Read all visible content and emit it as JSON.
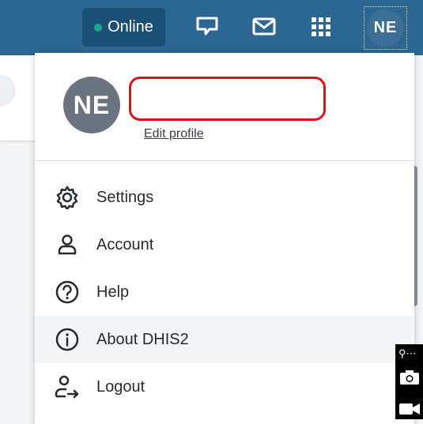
{
  "topbar": {
    "status_label": "Online",
    "status_color": "#19a88a",
    "icons": [
      "interpretations-icon",
      "mail-icon",
      "apps-icon"
    ],
    "avatar_initials": "NE"
  },
  "menu": {
    "avatar_initials": "NE",
    "edit_profile_label": "Edit profile",
    "items": [
      {
        "label": "Settings",
        "icon": "gear-icon"
      },
      {
        "label": "Account",
        "icon": "person-icon"
      },
      {
        "label": "Help",
        "icon": "help-icon"
      },
      {
        "label": "About DHIS2",
        "icon": "info-icon",
        "highlighted": true
      },
      {
        "label": "Logout",
        "icon": "logout-icon"
      }
    ]
  },
  "colors": {
    "topbar": "#2c6693",
    "accent_red": "#e0101a"
  }
}
